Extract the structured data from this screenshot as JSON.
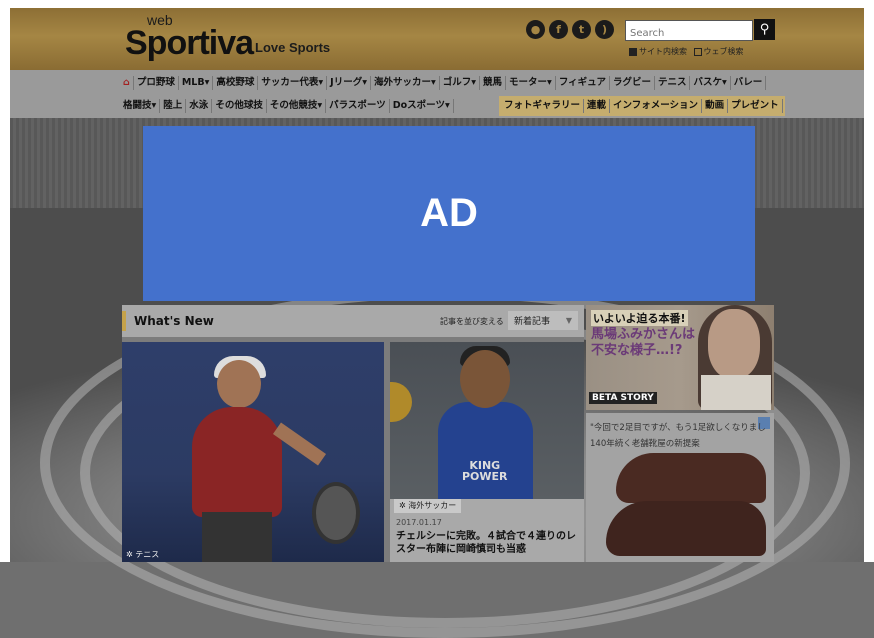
{
  "header": {
    "logo_web": "web",
    "logo_main": "Sportiva",
    "logo_tag": "Love Sports",
    "social": [
      "person-icon",
      "facebook-icon",
      "twitter-icon",
      "rss-icon"
    ],
    "search_placeholder": "Search",
    "search_opt_site": "サイト内検索",
    "search_opt_web": "ウェブ検索"
  },
  "nav": {
    "row1": [
      "プロ野球",
      "MLB▾",
      "高校野球",
      "サッカー代表▾",
      "Jリーグ▾",
      "海外サッカー▾",
      "ゴルフ▾",
      "競馬",
      "モーター▾",
      "フィギュア",
      "ラグビー",
      "テニス",
      "バスケ▾",
      "バレー"
    ],
    "row2": [
      "格闘技▾",
      "陸上",
      "水泳",
      "その他球技",
      "その他競技▾",
      "パラスポーツ",
      "Doスポーツ▾"
    ],
    "row2_right": [
      "フォトギャラリー",
      "連載",
      "インフォメーション",
      "動画",
      "プレゼント"
    ]
  },
  "ad": {
    "label": "AD"
  },
  "whats_new": {
    "title": "What's New",
    "sort_label": "記事を並び変える",
    "sort_value": "新着記事",
    "cards": [
      {
        "category": "テニス"
      },
      {
        "category": "海外サッカー",
        "date": "2017.01.17",
        "title": "チェルシーに完敗。４試合で４連りのレスター布陣に岡崎慎司も当惑",
        "sponsor_line1": "KING",
        "sponsor_line2": "POWER"
      }
    ]
  },
  "side_ads": {
    "beta": {
      "line1": "いよいよ迫る本番!",
      "line2": "馬場ふみかさんは不安な様子…!?",
      "brand": "BETA STORY"
    },
    "shoe": {
      "line1": "\"今回で2足目ですが、もう1足欲しくなりまし",
      "line2": "140年続く老舗靴屋の新提案"
    }
  }
}
